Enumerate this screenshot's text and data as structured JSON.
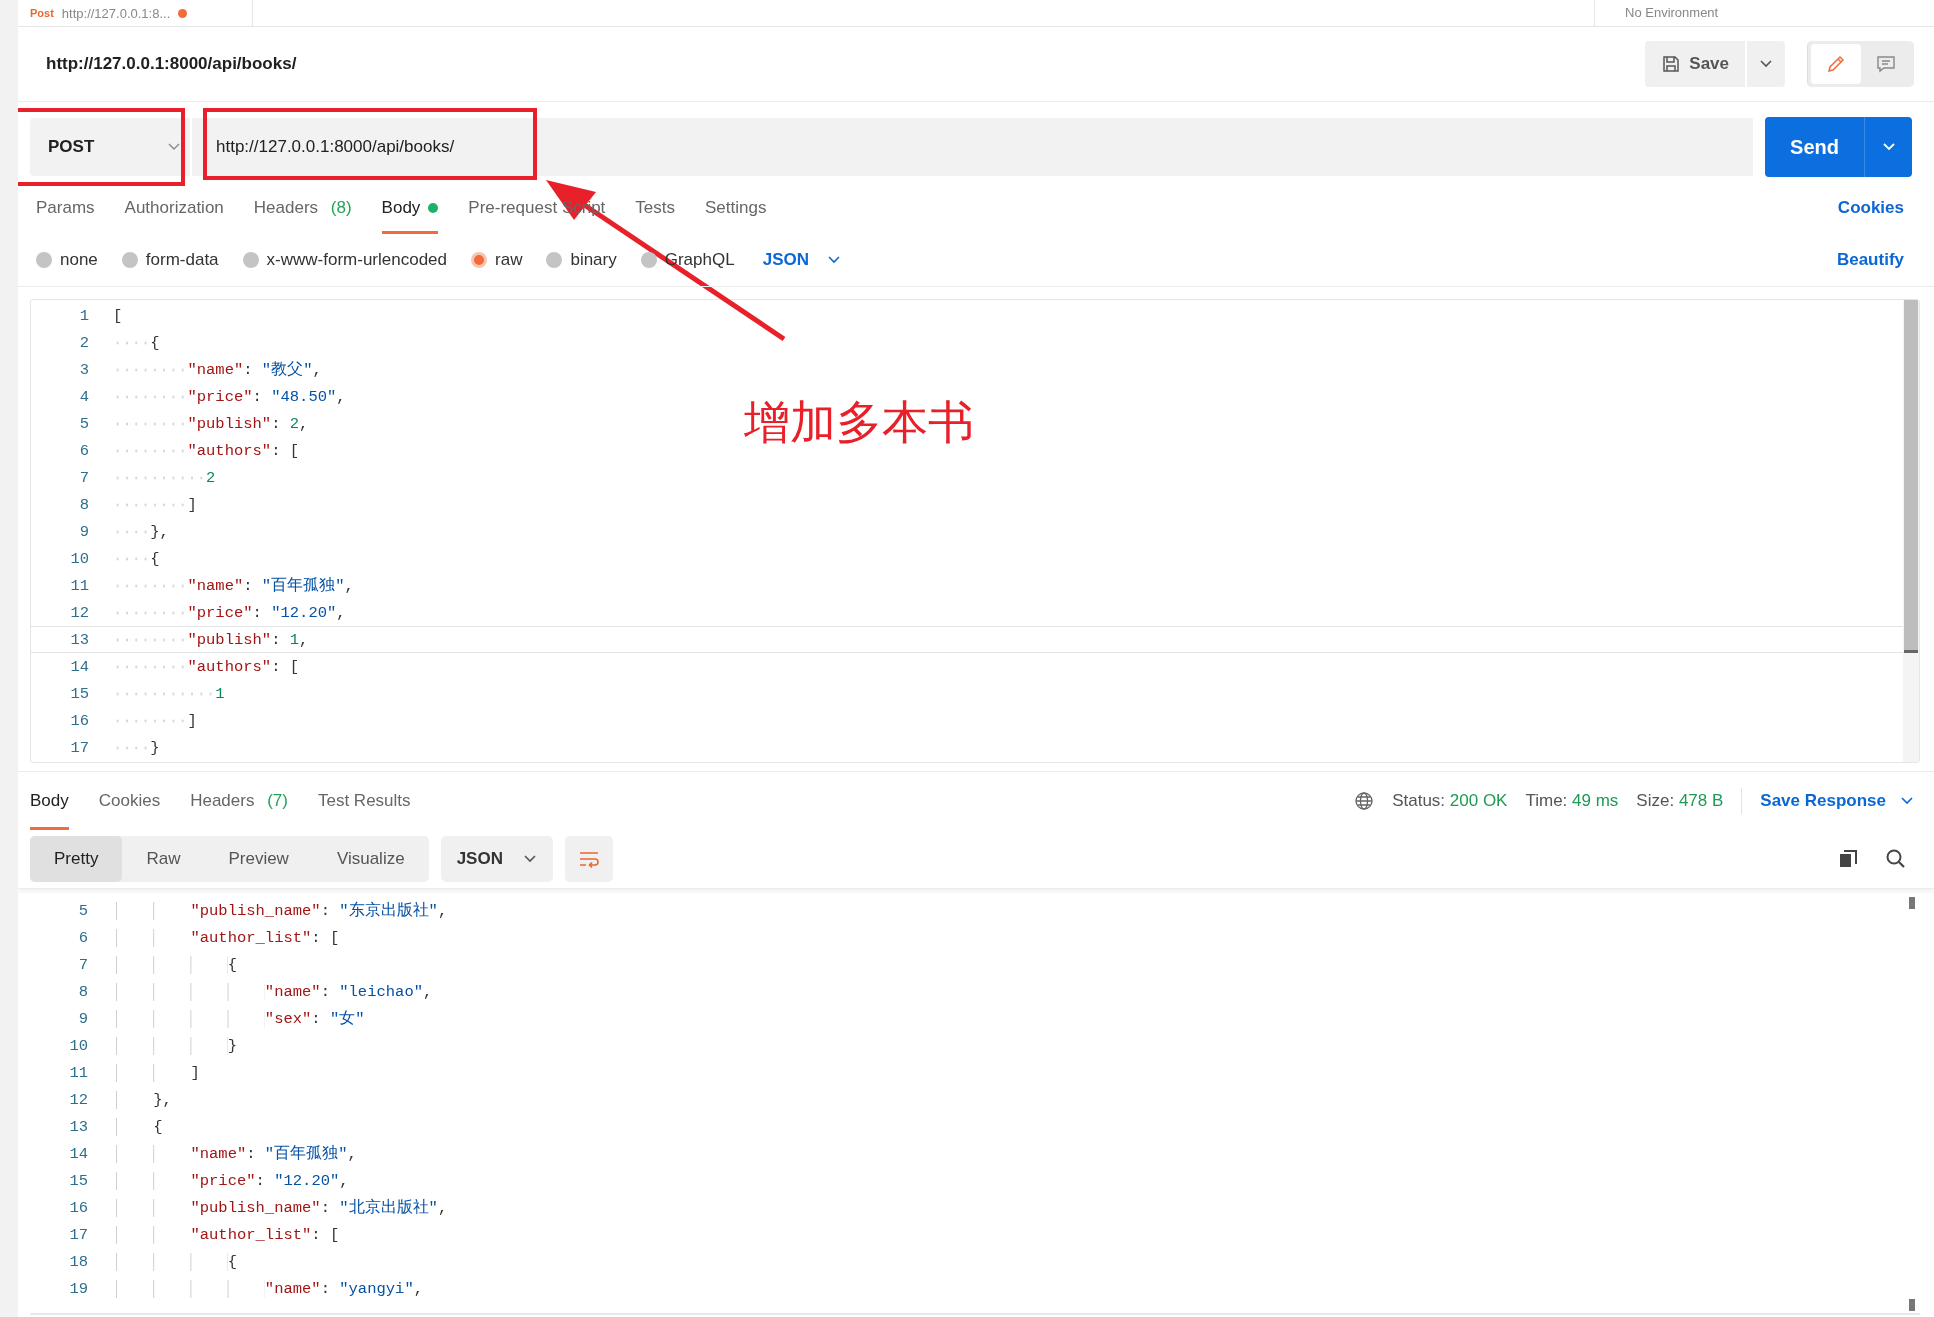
{
  "request_tab": {
    "method": "Post",
    "title": "http://127.0.0.1:8...",
    "unsaved": true
  },
  "environment": "No Environment",
  "title": "http://127.0.0.1:8000/api/books/",
  "save_button": "Save",
  "modes": [
    {
      "kind": "edit",
      "selected": true
    },
    {
      "kind": "comment",
      "selected": false
    }
  ],
  "request": {
    "method": "POST",
    "url": "http://127.0.0.1:8000/api/books/",
    "send": "Send"
  },
  "request_tabs": [
    {
      "label": "Params",
      "selected": false
    },
    {
      "label": "Authorization",
      "selected": false
    },
    {
      "label": "Headers",
      "count": "(8)",
      "selected": false
    },
    {
      "label": "Body",
      "selected": true,
      "has_content": true
    },
    {
      "label": "Pre-request Script",
      "selected": false
    },
    {
      "label": "Tests",
      "selected": false
    },
    {
      "label": "Settings",
      "selected": false
    }
  ],
  "cookies_link": "Cookies",
  "body_types": [
    {
      "label": "none",
      "selected": false
    },
    {
      "label": "form-data",
      "selected": false
    },
    {
      "label": "x-www-form-urlencoded",
      "selected": false
    },
    {
      "label": "raw",
      "selected": true
    },
    {
      "label": "binary",
      "selected": false
    },
    {
      "label": "GraphQL",
      "selected": false
    }
  ],
  "body_format": "JSON",
  "beautify": "Beautify",
  "request_body": [
    {
      "n": "1",
      "text": "["
    },
    {
      "n": "2",
      "text": "    {"
    },
    {
      "n": "3",
      "text": "        \"name\": \"教父\","
    },
    {
      "n": "4",
      "text": "        \"price\": \"48.50\","
    },
    {
      "n": "5",
      "text": "        \"publish\": 2,"
    },
    {
      "n": "6",
      "text": "        \"authors\": ["
    },
    {
      "n": "7",
      "text": "          2"
    },
    {
      "n": "8",
      "text": "        ]"
    },
    {
      "n": "9",
      "text": "    },"
    },
    {
      "n": "10",
      "text": "    {"
    },
    {
      "n": "11",
      "text": "        \"name\": \"百年孤独\","
    },
    {
      "n": "12",
      "text": "        \"price\": \"12.20\","
    },
    {
      "n": "13",
      "text": "        \"publish\": 1,",
      "current": true
    },
    {
      "n": "14",
      "text": "        \"authors\": ["
    },
    {
      "n": "15",
      "text": "           1"
    },
    {
      "n": "16",
      "text": "        ]"
    },
    {
      "n": "17",
      "text": "    }"
    }
  ],
  "annotation": "增加多本书",
  "response_tabs": [
    {
      "label": "Body",
      "selected": true
    },
    {
      "label": "Cookies",
      "selected": false
    },
    {
      "label": "Headers",
      "count": "(7)",
      "selected": false
    },
    {
      "label": "Test Results",
      "selected": false
    }
  ],
  "status": {
    "status_label": "Status:",
    "status": "200 OK",
    "time_label": "Time:",
    "time": "49 ms",
    "size_label": "Size:",
    "size": "478 B"
  },
  "save_response": "Save Response",
  "view_modes": [
    {
      "label": "Pretty",
      "selected": true
    },
    {
      "label": "Raw",
      "selected": false
    },
    {
      "label": "Preview",
      "selected": false
    },
    {
      "label": "Visualize",
      "selected": false
    }
  ],
  "response_format": "JSON",
  "response_body": [
    {
      "n": "5",
      "text": "        \"publish_name\": \"东京出版社\","
    },
    {
      "n": "6",
      "text": "        \"author_list\": ["
    },
    {
      "n": "7",
      "text": "            {"
    },
    {
      "n": "8",
      "text": "                \"name\": \"leichao\","
    },
    {
      "n": "9",
      "text": "                \"sex\": \"女\""
    },
    {
      "n": "10",
      "text": "            }"
    },
    {
      "n": "11",
      "text": "        ]"
    },
    {
      "n": "12",
      "text": "    },"
    },
    {
      "n": "13",
      "text": "    {"
    },
    {
      "n": "14",
      "text": "        \"name\": \"百年孤独\","
    },
    {
      "n": "15",
      "text": "        \"price\": \"12.20\","
    },
    {
      "n": "16",
      "text": "        \"publish_name\": \"北京出版社\","
    },
    {
      "n": "17",
      "text": "        \"author_list\": ["
    },
    {
      "n": "18",
      "text": "            {"
    },
    {
      "n": "19",
      "text": "                \"name\": \"yangyi\","
    }
  ]
}
